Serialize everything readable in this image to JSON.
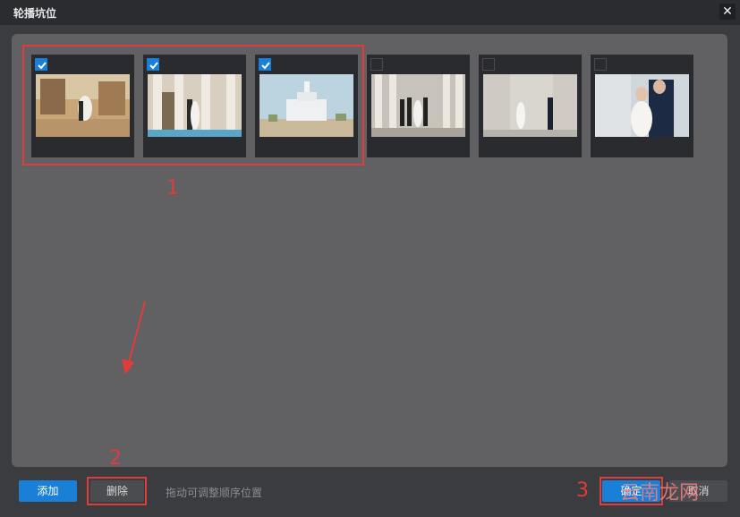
{
  "dialog": {
    "title": "轮播坑位",
    "close_icon": "close-icon"
  },
  "thumbnails": [
    {
      "checked": true,
      "scene": "couple-dip-street"
    },
    {
      "checked": true,
      "scene": "couple-columns"
    },
    {
      "checked": true,
      "scene": "temple"
    },
    {
      "checked": false,
      "scene": "walking-colonnade"
    },
    {
      "checked": false,
      "scene": "couple-stone-wall"
    },
    {
      "checked": false,
      "scene": "couple-closeup"
    }
  ],
  "annotations": {
    "label_1": "1",
    "label_2": "2",
    "label_3": "3",
    "color": "#e03c3c"
  },
  "footer": {
    "add_label": "添加",
    "delete_label": "删除",
    "hint": "拖动可调整顺序位置",
    "ok_label": "确定",
    "cancel_label": "取消"
  },
  "watermark": "云南龙网",
  "colors": {
    "accent": "#1a7fd6",
    "background": "#3b3c40",
    "panel": "#616164"
  }
}
